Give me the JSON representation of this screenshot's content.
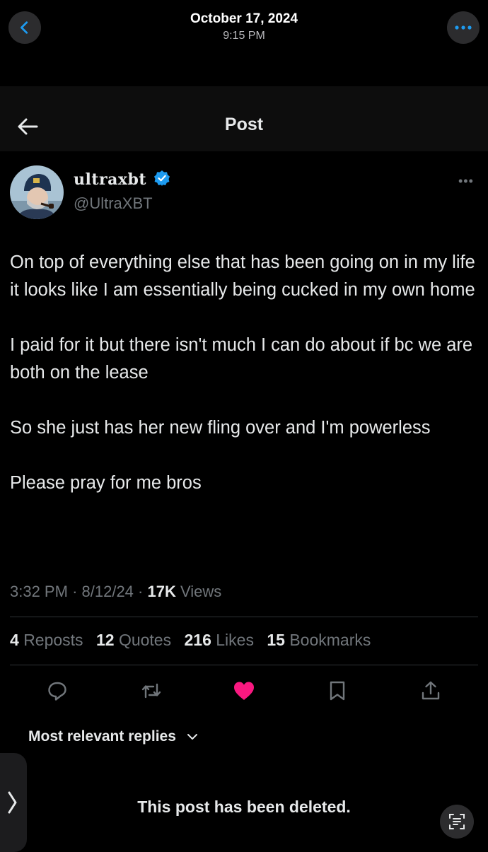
{
  "status_header": {
    "date": "October 17, 2024",
    "time": "9:15 PM"
  },
  "nav": {
    "title": "Post"
  },
  "post": {
    "display_name": "ultraxbt",
    "handle": "@UltraXBT",
    "verified": true,
    "paragraphs": [
      "On top of everything else that has been going on in my life it looks like I am essentially being cucked in my own home",
      "I paid for it but there isn't much I can do about if bc we are both on the lease",
      "So she just has her new fling over and I'm powerless",
      "Please pray for me bros"
    ],
    "time": "3:32 PM",
    "date": "8/12/24",
    "views_count": "17K",
    "views_label": "Views",
    "separator": "·"
  },
  "stats": {
    "reposts_count": "4",
    "reposts_label": "Reposts",
    "quotes_count": "12",
    "quotes_label": "Quotes",
    "likes_count": "216",
    "likes_label": "Likes",
    "bookmarks_count": "15",
    "bookmarks_label": "Bookmarks"
  },
  "actions": [
    "reply-icon",
    "repost-icon",
    "like-icon",
    "bookmark-icon",
    "share-icon"
  ],
  "replies": {
    "sort_label": "Most relevant replies",
    "deleted_notice": "This post has been deleted."
  },
  "colors": {
    "background": "#000000",
    "text": "#e7e9ea",
    "muted": "#71767b",
    "accent": "#1d9bf0",
    "like": "#f91880",
    "divider": "#2f3336"
  }
}
